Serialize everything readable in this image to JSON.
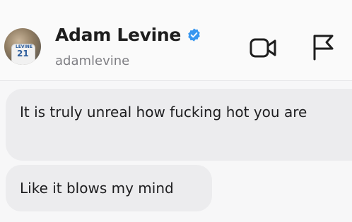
{
  "header": {
    "display_name": "Adam Levine",
    "username": "adamlevine",
    "avatar_jersey_name": "LEVINE",
    "avatar_jersey_number": "21",
    "icons": {
      "verified": "verified-badge-icon",
      "video_call": "video-camera-icon",
      "report": "flag-icon"
    },
    "colors": {
      "verified_badge": "#3897f0"
    }
  },
  "messages": [
    {
      "text": "It is truly unreal how fucking hot you are"
    },
    {
      "text": "Like it blows my mind"
    }
  ]
}
